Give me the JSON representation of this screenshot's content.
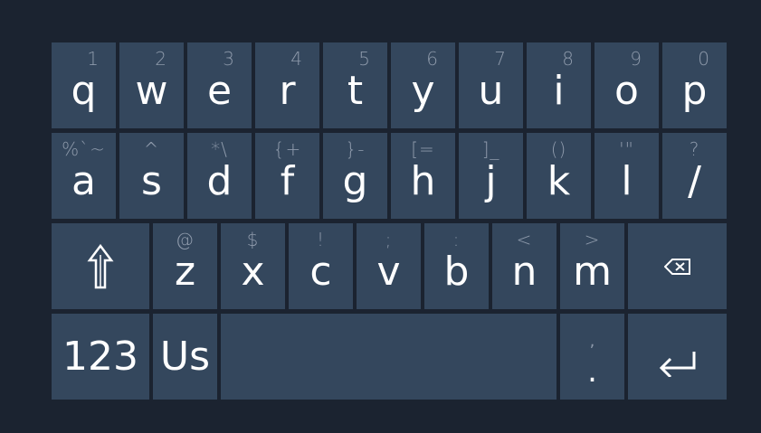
{
  "keyboard": {
    "row1": [
      {
        "main": "q",
        "alt": "1"
      },
      {
        "main": "w",
        "alt": "2"
      },
      {
        "main": "e",
        "alt": "3"
      },
      {
        "main": "r",
        "alt": "4"
      },
      {
        "main": "t",
        "alt": "5"
      },
      {
        "main": "y",
        "alt": "6"
      },
      {
        "main": "u",
        "alt": "7"
      },
      {
        "main": "i",
        "alt": "8"
      },
      {
        "main": "o",
        "alt": "9"
      },
      {
        "main": "p",
        "alt": "0"
      }
    ],
    "row2": [
      {
        "main": "a",
        "alt": "%`~"
      },
      {
        "main": "s",
        "alt": "^"
      },
      {
        "main": "d",
        "alt": "*\\"
      },
      {
        "main": "f",
        "alt": "{+"
      },
      {
        "main": "g",
        "alt": "}-"
      },
      {
        "main": "h",
        "alt": "[="
      },
      {
        "main": "j",
        "alt": "]_"
      },
      {
        "main": "k",
        "alt": "()"
      },
      {
        "main": "l",
        "alt": "'\""
      },
      {
        "main": "/",
        "alt": "?"
      }
    ],
    "row3": [
      {
        "main": "z",
        "alt": "@"
      },
      {
        "main": "x",
        "alt": "$"
      },
      {
        "main": "c",
        "alt": "!"
      },
      {
        "main": "v",
        "alt": ";"
      },
      {
        "main": "b",
        "alt": ":"
      },
      {
        "main": "n",
        "alt": "<"
      },
      {
        "main": "m",
        "alt": ">"
      }
    ],
    "numbers_label": "123",
    "layout_label": "Us",
    "period": {
      "main": ".",
      "alt": ","
    },
    "icons": {
      "shift": "shift-icon",
      "backspace": "backspace-icon",
      "enter": "enter-icon"
    },
    "colors": {
      "background": "#1b2330",
      "key": "#34475d",
      "label": "#ffffff",
      "alt_label": "#8e9aab"
    }
  }
}
